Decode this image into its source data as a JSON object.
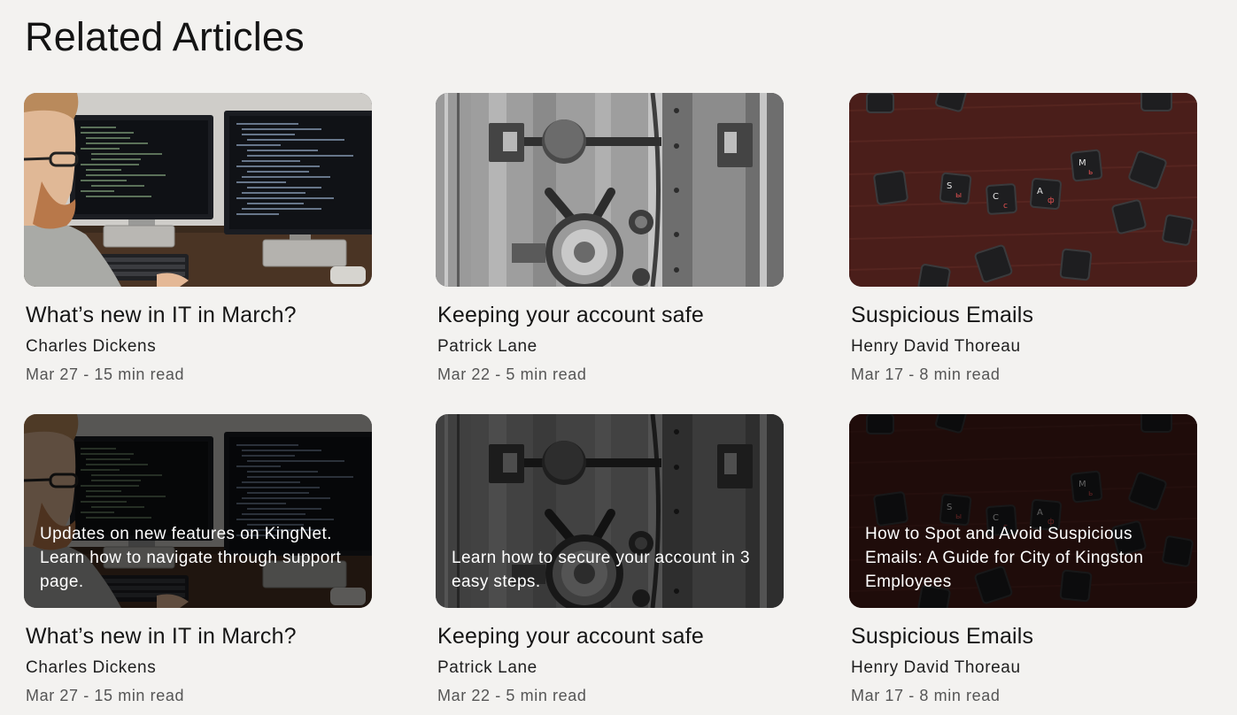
{
  "page": {
    "title": "Related Articles"
  },
  "articles": [
    {
      "image": "developer-at-monitors-photo",
      "title": "What’s new in IT in March?",
      "author": "Charles Dickens",
      "meta": "Mar 27 - 15 min read"
    },
    {
      "image": "bank-vault-door-photo",
      "title": "Keeping your account safe",
      "author": "Patrick Lane",
      "meta": "Mar 22 - 5 min read"
    },
    {
      "image": "scattered-keyboard-keys-photo",
      "title": "Suspicious Emails",
      "author": "Henry David Thoreau",
      "meta": "Mar 17 - 8 min read"
    },
    {
      "image": "developer-at-monitors-photo",
      "title": "What’s new in IT in March?",
      "author": "Charles Dickens",
      "meta": "Mar 27 - 15 min read",
      "summary": "Updates on new features on KingNet. Learn how to navigate through support page."
    },
    {
      "image": "bank-vault-door-photo",
      "title": "Keeping your account safe",
      "author": "Patrick Lane",
      "meta": "Mar 22 - 5 min read",
      "summary": "Learn how to secure your account in 3 easy steps."
    },
    {
      "image": "scattered-keyboard-keys-photo",
      "title": "Suspicious Emails",
      "author": "Henry David Thoreau",
      "meta": "Mar 17 - 8 min read",
      "summary": "How to Spot and Avoid Suspicious Emails: A Guide for City of Kingston Employees"
    }
  ]
}
